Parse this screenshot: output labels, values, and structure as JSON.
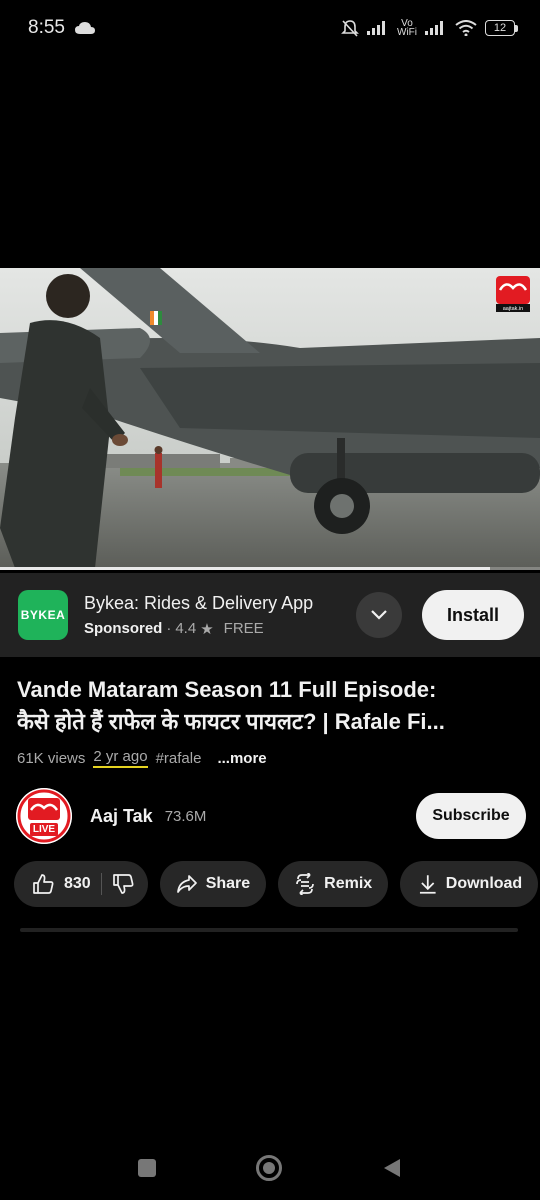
{
  "status_bar": {
    "time": "8:55",
    "vowifi_top": "Vo",
    "vowifi_bottom": "WiFi",
    "battery": "12",
    "icons": [
      "cloud-icon",
      "bell-off-icon",
      "signal-icon",
      "wifi-icon",
      "battery-icon"
    ]
  },
  "video": {
    "watermark": "aajtak.in",
    "progress": 0.907
  },
  "ad": {
    "logo_text": "BYKEA",
    "title": "Bykea: Rides & Delivery App",
    "sponsored": "Sponsored",
    "rating": "4.4",
    "price": "FREE",
    "install_label": "Install"
  },
  "title": {
    "line1": "Vande Mataram Season 11 Full Episode:",
    "line2": "कैसे होते हैं राफेल के फायटर पायलट? | Rafale Fi..."
  },
  "meta": {
    "views": "61K views",
    "ago": "2 yr ago",
    "tag": "#rafale",
    "more": "...more"
  },
  "channel": {
    "name": "Aaj Tak",
    "subscribers": "73.6M",
    "live_badge": "LIVE",
    "subscribe_label": "Subscribe"
  },
  "actions": {
    "likes": "830",
    "share": "Share",
    "remix": "Remix",
    "download": "Download"
  },
  "colors": {
    "background": "#000000",
    "pill": "#272727",
    "ad_bg": "#222222",
    "bykea_green": "#1fb35a",
    "aajtak_red": "#e21b22",
    "highlight_underline": "#e5d321"
  }
}
